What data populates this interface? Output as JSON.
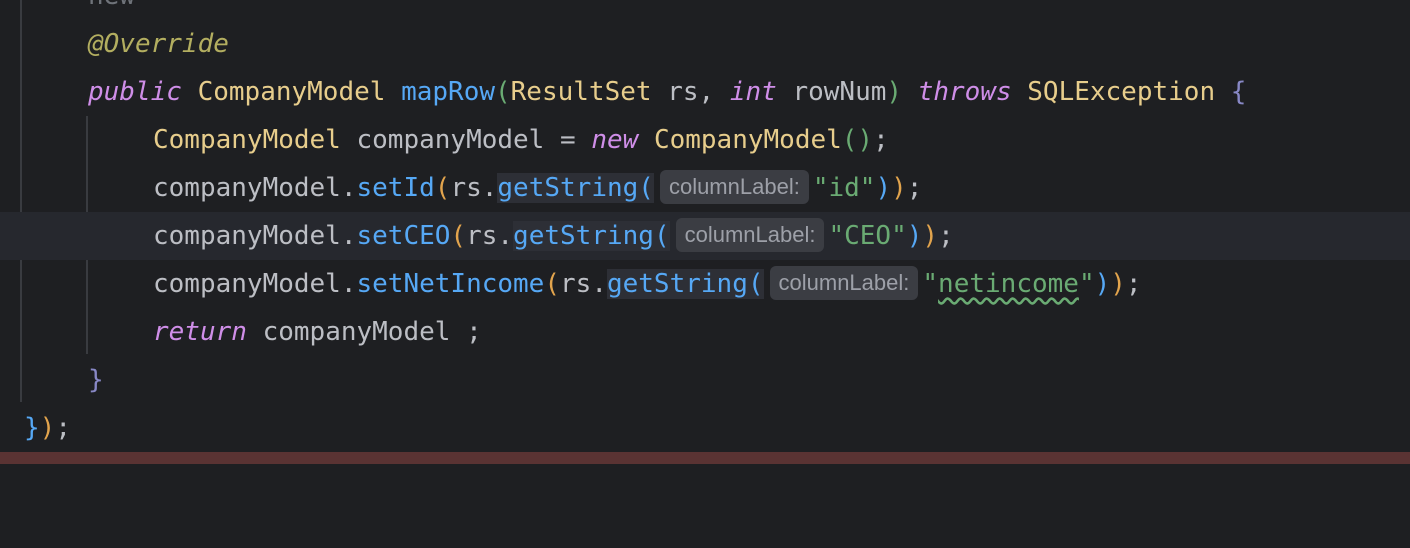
{
  "editor": {
    "lines": {
      "fragment_new": "new",
      "annotation": "@Override",
      "signature": {
        "modifier": "public",
        "return_type": "CompanyModel",
        "method": "mapRow",
        "param1_type": "ResultSet",
        "param1_name": "rs",
        "param2_type": "int",
        "param2_name": "rowNum",
        "throws_kw": "throws",
        "exception": "SQLException",
        "open_brace": "{"
      },
      "decl": {
        "type": "CompanyModel",
        "var": "companyModel",
        "assign": " = ",
        "new_kw": "new",
        "ctor": "CompanyModel",
        "parens": "()",
        "semi": ";"
      },
      "set_id": {
        "object": "companyModel",
        "method": "setId",
        "rs": "rs",
        "getter": "getString",
        "hint": "columnLabel:",
        "arg": "\"id\"",
        "close": "));"
      },
      "set_ceo": {
        "object": "companyModel",
        "method": "setCEO",
        "rs": "rs",
        "getter": "getString",
        "hint": "columnLabel:",
        "arg": "\"CEO\"",
        "close": "));"
      },
      "set_net_income": {
        "object": "companyModel",
        "method": "setNetIncome",
        "rs": "rs",
        "getter": "getString",
        "hint": "columnLabel:",
        "arg_quote_open": "\"",
        "arg_text": "netincome",
        "arg_quote_close": "\"",
        "close": "));"
      },
      "ret": {
        "keyword": "return",
        "value": "companyModel ;"
      },
      "close_method": "}",
      "close_block": "});"
    }
  },
  "colors": {
    "background": "#1e1f22",
    "current_line": "#26282e",
    "keyword": "#cf8ee8",
    "annotation": "#b3ae60",
    "type": "#e7cd8c",
    "method": "#56a8f5",
    "string": "#6aab73",
    "hint_bg": "#3b3d43",
    "status_bar": "#5a3333"
  }
}
